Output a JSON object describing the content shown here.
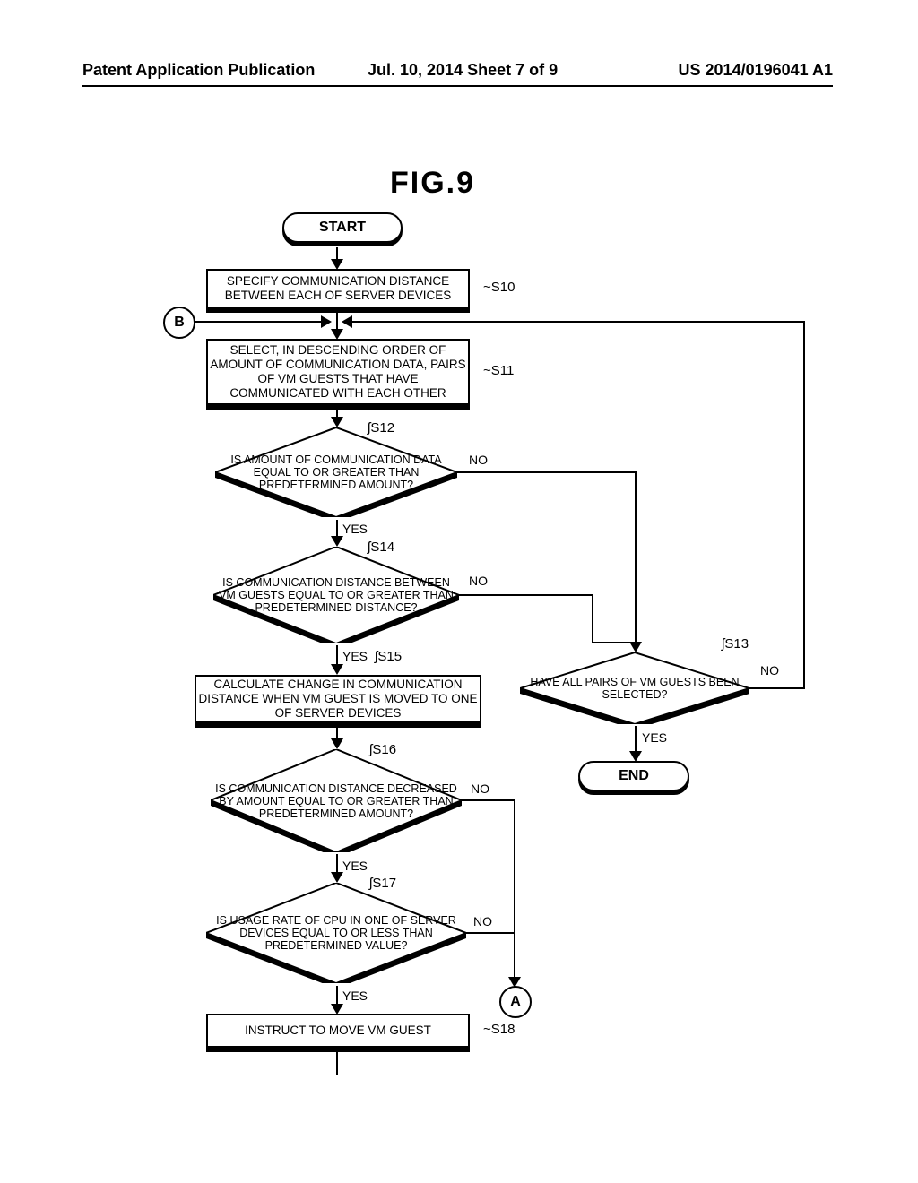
{
  "header": {
    "left": "Patent Application Publication",
    "mid": "Jul. 10, 2014  Sheet 7 of 9",
    "right": "US 2014/0196041 A1"
  },
  "figure_title": "FIG.9",
  "nodes": {
    "start": "START",
    "end": "END",
    "B": "B",
    "A": "A",
    "s10": {
      "label": "S10",
      "text": "SPECIFY COMMUNICATION DISTANCE BETWEEN EACH OF SERVER DEVICES"
    },
    "s11": {
      "label": "S11",
      "text": "SELECT, IN DESCENDING ORDER OF AMOUNT OF COMMUNICATION DATA, PAIRS OF VM GUESTS THAT HAVE COMMUNICATED WITH EACH OTHER"
    },
    "s12": {
      "label": "S12",
      "text": "IS AMOUNT OF COMMUNICATION DATA EQUAL TO OR GREATER THAN PREDETERMINED AMOUNT?"
    },
    "s13": {
      "label": "S13",
      "text": "HAVE ALL PAIRS OF VM GUESTS BEEN SELECTED?"
    },
    "s14": {
      "label": "S14",
      "text": "IS COMMUNICATION DISTANCE BETWEEN VM GUESTS EQUAL TO OR GREATER THAN PREDETERMINED DISTANCE?"
    },
    "s15": {
      "label": "S15",
      "text": "CALCULATE CHANGE IN COMMUNICATION DISTANCE WHEN VM GUEST IS MOVED TO ONE OF SERVER DEVICES"
    },
    "s16": {
      "label": "S16",
      "text": "IS COMMUNICATION DISTANCE DECREASED BY AMOUNT EQUAL TO OR GREATER THAN PREDETERMINED AMOUNT?"
    },
    "s17": {
      "label": "S17",
      "text": "IS USAGE RATE OF CPU IN ONE OF SERVER DEVICES EQUAL TO OR LESS THAN PREDETERMINED VALUE?"
    },
    "s18": {
      "label": "S18",
      "text": "INSTRUCT TO MOVE VM GUEST"
    }
  },
  "edges": {
    "yes": "YES",
    "no": "NO"
  }
}
